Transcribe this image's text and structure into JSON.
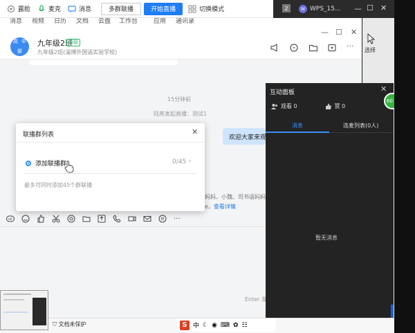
{
  "topbar": {
    "items": [
      {
        "label": "露脸"
      },
      {
        "label": "麦克"
      },
      {
        "label": "消息"
      }
    ],
    "multi_group_label": "多群联播",
    "start_live_label": "开始直播",
    "switch_mode_label": "切换模式"
  },
  "taskbar": {
    "badge": "2",
    "wps_label": "WPS_15..."
  },
  "chat_menu_fragments": [
    "消息",
    "视频",
    "日历",
    "文档",
    "云盘",
    "工作台",
    "应用",
    "通讯录"
  ],
  "group": {
    "avatar_text": [
      "高",
      "中",
      "部"
    ],
    "name": "九年级2班",
    "tag": "班级",
    "subtitle": "九年级2班(淄博外国语实验学校)"
  },
  "header_tools": {
    "select_label": "选择"
  },
  "messages": {
    "time": "15分钟前",
    "notice": "陆燕发起直播：测试1",
    "bubble": "欢迎大家来观",
    "hint_line1": "妈妈、小魏、司书语妈妈、",
    "hint_line2_prefix": "e，",
    "hint_line2_link": "查看详情"
  },
  "input": {
    "enter_hint": "Enter 发"
  },
  "popup": {
    "title": "联播群列表",
    "add_label": "添加联播群",
    "count": "0/45",
    "note": "最多可同时添加45个群联播"
  },
  "panel": {
    "title": "互动面板",
    "viewers": "观看 0",
    "likes": "赞 0",
    "tab_messages": "消息",
    "tab_mic": "连麦列表(0人)",
    "empty": "暂无消息"
  },
  "side_badge": "60",
  "status": {
    "doc_label": "文档未保护"
  },
  "ime": {
    "logo": "S",
    "lang": "中"
  },
  "colors": {
    "accent_blue": "#1e7cf5",
    "panel_bg": "#232323",
    "bubble_bg": "#cfe5ff",
    "badge_green": "#36b53d"
  }
}
